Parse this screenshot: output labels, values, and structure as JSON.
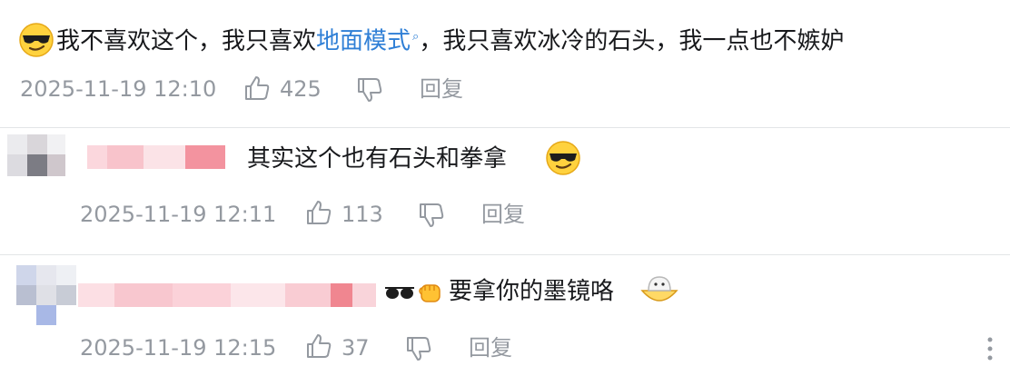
{
  "comments": [
    {
      "text_before": "我不喜欢这个，我只喜欢",
      "link": "地面模式",
      "link_icon": "search-icon",
      "text_after": "，我只喜欢冰冷的石头，我一点也不嫉妒",
      "emoji": "sunglasses-face",
      "time": "2025-11-19 12:10",
      "likes": "425",
      "reply_label": "回复"
    },
    {
      "username_hidden": true,
      "text": "其实这个也有石头和拳拿",
      "emoji": "sunglasses-face",
      "time": "2025-11-19 12:11",
      "likes": "113",
      "reply_label": "回复"
    },
    {
      "username_hidden": true,
      "text": "要拿你的墨镜咯",
      "emoji_prefix": [
        "sunglasses",
        "fist"
      ],
      "emoji_suffix": "ghost-bowl-face",
      "time": "2025-11-19 12:15",
      "likes": "37",
      "reply_label": "回复"
    }
  ],
  "icons": [
    "like-icon",
    "dislike-icon",
    "more-icon"
  ],
  "colors": {
    "text": "#18191c",
    "meta": "#9499a0",
    "link": "#2f7fd6",
    "mosaic_pink": "#f6b7c0",
    "mosaic_red": "#f07a86",
    "mosaic_gray": "#7c7c84"
  }
}
